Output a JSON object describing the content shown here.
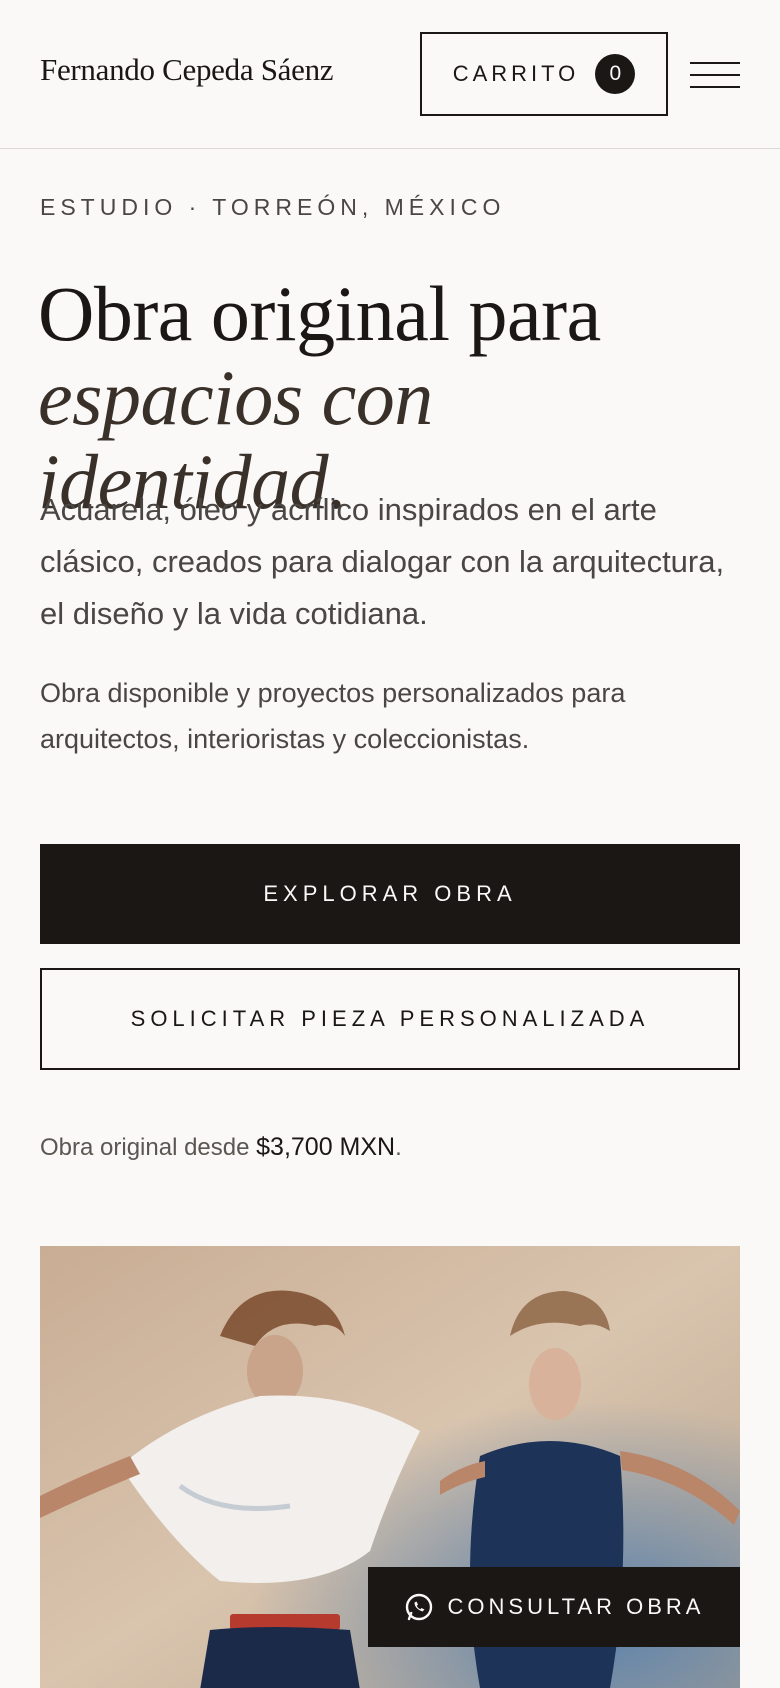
{
  "header": {
    "brand": "Fernando Cepeda Sáenz",
    "cart_label": "CARRITO",
    "cart_count": "0",
    "menu_icon": "hamburger-menu-icon"
  },
  "hero": {
    "eyebrow": "ESTUDIO · TORREÓN, MÉXICO",
    "headline_line1": "Obra original para",
    "headline_line2": "espacios con identidad.",
    "lead": "Acuarela, óleo y acrílico inspirados en el arte clásico, creados para dialogar con la arquitectura, el diseño y la vida cotidiana.",
    "sub": "Obra disponible y proyectos personalizados para arquitectos, interioristas y coleccionistas.",
    "primary_cta": "EXPLORAR OBRA",
    "secondary_cta": "SOLICITAR PIEZA PERSONALIZADA",
    "price_prefix": "Obra original desde",
    "price_value": "$3,700 MXN",
    "price_suffix": "."
  },
  "floating": {
    "whatsapp_label": "CONSULTAR OBRA",
    "whatsapp_icon": "whatsapp-icon"
  },
  "colors": {
    "background": "#faf9f7",
    "ink": "#1a1715",
    "muted_text": "#4a4643"
  }
}
